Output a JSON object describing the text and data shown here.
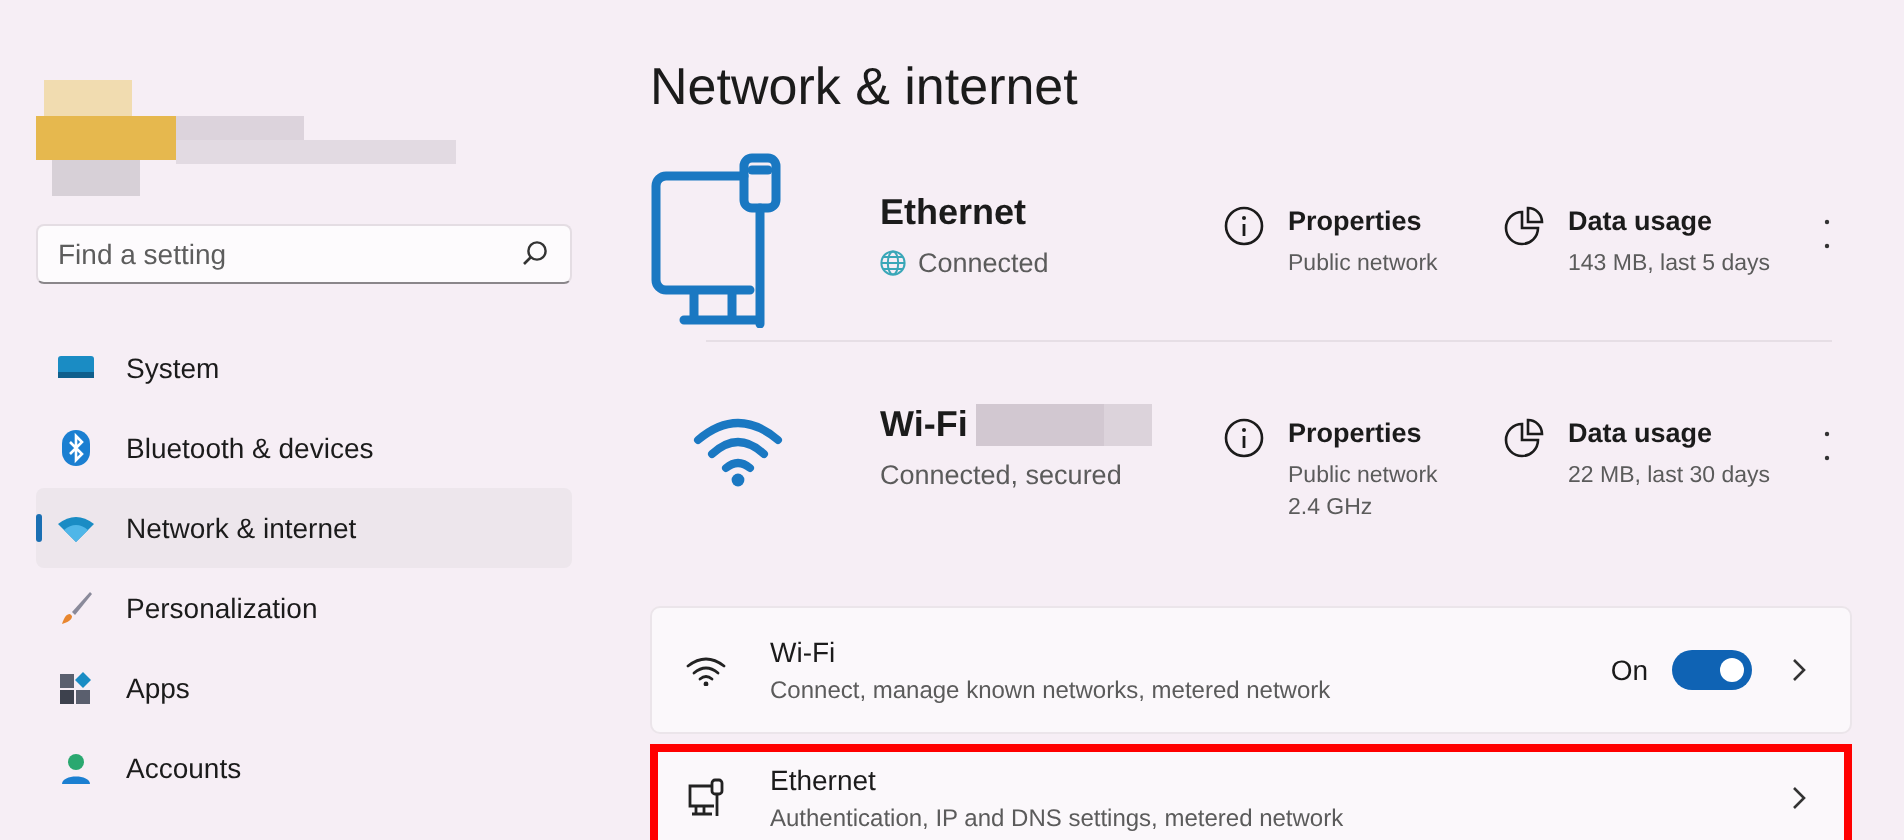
{
  "sidebar": {
    "search": {
      "placeholder": "Find a setting"
    },
    "items": [
      {
        "label": "System",
        "kind": "system",
        "selected": false
      },
      {
        "label": "Bluetooth & devices",
        "kind": "bluetooth",
        "selected": false
      },
      {
        "label": "Network & internet",
        "kind": "network",
        "selected": true
      },
      {
        "label": "Personalization",
        "kind": "brush",
        "selected": false
      },
      {
        "label": "Apps",
        "kind": "apps",
        "selected": false
      },
      {
        "label": "Accounts",
        "kind": "accounts",
        "selected": false
      }
    ]
  },
  "page_title": "Network & internet",
  "connections": [
    {
      "kind": "ethernet",
      "name": "Ethernet",
      "name_redacted": false,
      "status": "Connected",
      "status_globe": true,
      "properties": {
        "title": "Properties",
        "lines": [
          "Public network"
        ]
      },
      "data_usage": {
        "title": "Data usage",
        "detail": "143 MB, last 5 days"
      }
    },
    {
      "kind": "wifi",
      "name": "Wi-Fi",
      "name_redacted": true,
      "status": "Connected, secured",
      "status_globe": false,
      "properties": {
        "title": "Properties",
        "lines": [
          "Public network",
          "2.4 GHz"
        ]
      },
      "data_usage": {
        "title": "Data usage",
        "detail": "22 MB, last 30 days"
      }
    }
  ],
  "settings": [
    {
      "kind": "wifi",
      "title": "Wi-Fi",
      "subtitle": "Connect, manage known networks, metered network",
      "toggle": {
        "label": "On",
        "on": true
      },
      "highlighted": false
    },
    {
      "kind": "ethernet",
      "title": "Ethernet",
      "subtitle": "Authentication, IP and DNS settings, metered network",
      "highlighted": true
    }
  ]
}
